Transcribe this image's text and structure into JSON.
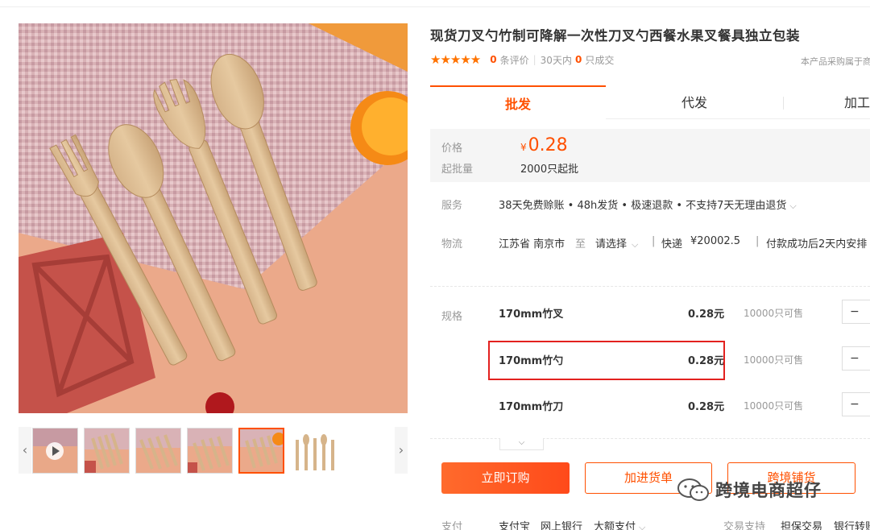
{
  "product": {
    "title": "现货刀叉勺竹制可降解一次性刀叉勺西餐水果叉餐具独立包装",
    "stars": "★★★★★",
    "review_count": "0",
    "review_label": "条评价",
    "sales_period": "30天内",
    "sales_count": "0",
    "sales_label": "只成交",
    "purchase_note": "本产品采购属于商"
  },
  "tabs": [
    {
      "label": "批发"
    },
    {
      "label": "代发"
    },
    {
      "label": "加工"
    }
  ],
  "price_box": {
    "price_label": "价格",
    "currency": "¥",
    "price": "0.28",
    "min_label": "起批量",
    "min_value": "2000只起批"
  },
  "service": {
    "label": "服务",
    "text": "38天免费赊账 • 48h发货 • 极速退款 • 不支持7天无理由退货"
  },
  "logistics": {
    "label": "物流",
    "from": "江苏省 南京市",
    "to_word": "至",
    "to_select": "请选择",
    "express": "快递",
    "fee": "¥20002.5",
    "ship_time": "付款成功后2天内安排"
  },
  "spec": {
    "label": "规格",
    "items": [
      {
        "name": "170mm竹叉",
        "price": "0.28元",
        "stock": "10000只可售",
        "qty_sym": "−"
      },
      {
        "name": "170mm竹勺",
        "price": "0.28元",
        "stock": "10000只可售",
        "qty_sym": "−"
      },
      {
        "name": "170mm竹刀",
        "price": "0.28元",
        "stock": "10000只可售",
        "qty_sym": "−"
      }
    ]
  },
  "actions": {
    "buy": "立即订购",
    "cart": "加进货单",
    "distribute": "跨境铺货"
  },
  "watermark": "跨境电商超仔",
  "payment": {
    "label": "支付",
    "m1": "支付宝",
    "m2": "网上银行",
    "m3": "大额支付",
    "trade_label": "交易支持",
    "t1": "担保交易",
    "t2": "银行转账"
  },
  "gallery": {
    "prev": "‹",
    "next": "›"
  },
  "colors": {
    "accent": "#ff5000",
    "highlight": "#e3211f"
  }
}
